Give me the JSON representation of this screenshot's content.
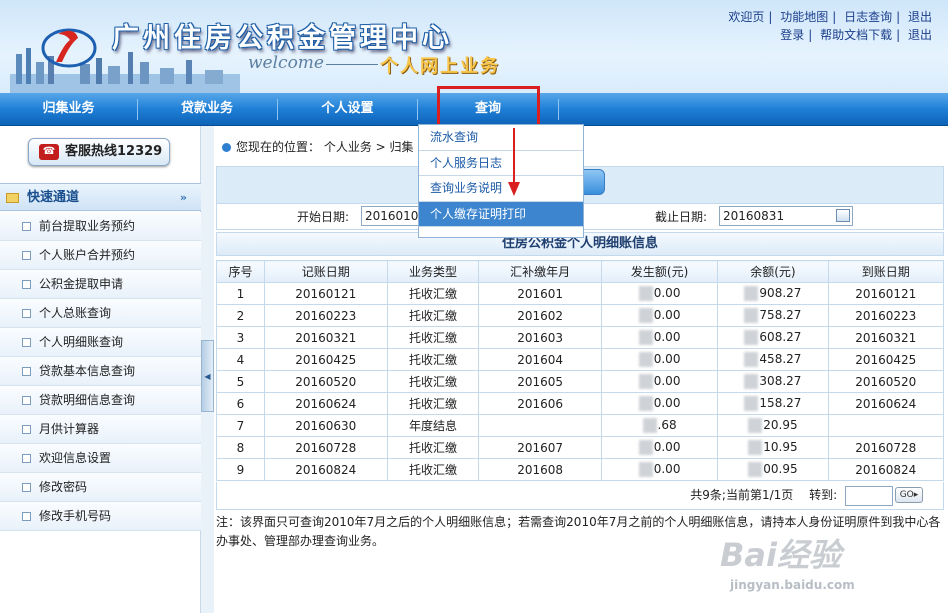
{
  "header": {
    "title": "广州住房公积金管理中心",
    "welcome": "welcome",
    "subtitle": "个人网上业务",
    "top_links_row1": [
      "欢迎页",
      "功能地图",
      "日志查询",
      "退出"
    ],
    "top_links_row2": [
      "登录",
      "帮助文档下载",
      "退出"
    ]
  },
  "nav": {
    "items": [
      "归集业务",
      "贷款业务",
      "个人设置",
      "查询"
    ],
    "active": "查询"
  },
  "dropdown": {
    "items": [
      "流水查询",
      "个人服务日志",
      "查询业务说明",
      "个人缴存证明打印"
    ],
    "highlighted": "个人缴存证明打印"
  },
  "sidebar": {
    "hotline": "客服热线12329",
    "section_title": "快速通道",
    "items": [
      "前台提取业务预约",
      "个人账户合并预约",
      "公积金提取申请",
      "个人总账查询",
      "个人明细账查询",
      "贷款基本信息查询",
      "贷款明细信息查询",
      "月供计算器",
      "欢迎信息设置",
      "修改密码",
      "修改手机号码"
    ]
  },
  "breadcrumb": "您现在的位置： 个人业务 > 归集",
  "filter": {
    "start_label": "开始日期:",
    "start_value": "2016010",
    "end_label": "截止日期:",
    "end_value": "20160831"
  },
  "table": {
    "caption": "住房公积金个人明细账信息",
    "columns": [
      "序号",
      "记账日期",
      "业务类型",
      "汇补缴年月",
      "发生额(元)",
      "余额(元)",
      "到账日期"
    ],
    "rows": [
      [
        "1",
        "20160121",
        "托收汇缴",
        "201601",
        "0.00",
        "908.27",
        "20160121"
      ],
      [
        "2",
        "20160223",
        "托收汇缴",
        "201602",
        "0.00",
        "758.27",
        "20160223"
      ],
      [
        "3",
        "20160321",
        "托收汇缴",
        "201603",
        "0.00",
        "608.27",
        "20160321"
      ],
      [
        "4",
        "20160425",
        "托收汇缴",
        "201604",
        "0.00",
        "458.27",
        "20160425"
      ],
      [
        "5",
        "20160520",
        "托收汇缴",
        "201605",
        "0.00",
        "308.27",
        "20160520"
      ],
      [
        "6",
        "20160624",
        "托收汇缴",
        "201606",
        "0.00",
        "158.27",
        "20160624"
      ],
      [
        "7",
        "20160630",
        "年度结息",
        "",
        ".68",
        "20.95",
        ""
      ],
      [
        "8",
        "20160728",
        "托收汇缴",
        "201607",
        "0.00",
        "10.95",
        "20160728"
      ],
      [
        "9",
        "20160824",
        "托收汇缴",
        "201608",
        "0.00",
        "00.95",
        "20160824"
      ]
    ]
  },
  "pager": {
    "summary": "共9条;当前第1/1页",
    "goto_label": "转到:",
    "go_label": "GO"
  },
  "note": "注：该界面只可查询2010年7月之后的个人明细账信息；若需查询2010年7月之前的个人明细账信息，请持本人身份证明原件到我中心各办事处、管理部办理查询业务。",
  "watermark": {
    "big": "Bai经验",
    "small": "jingyan.baidu.com"
  },
  "colors": {
    "nav_blue": "#1f7fd6",
    "highlight_red": "#d91f1f",
    "link_blue": "#1b3e8c",
    "active_item": "#3d86cf"
  }
}
